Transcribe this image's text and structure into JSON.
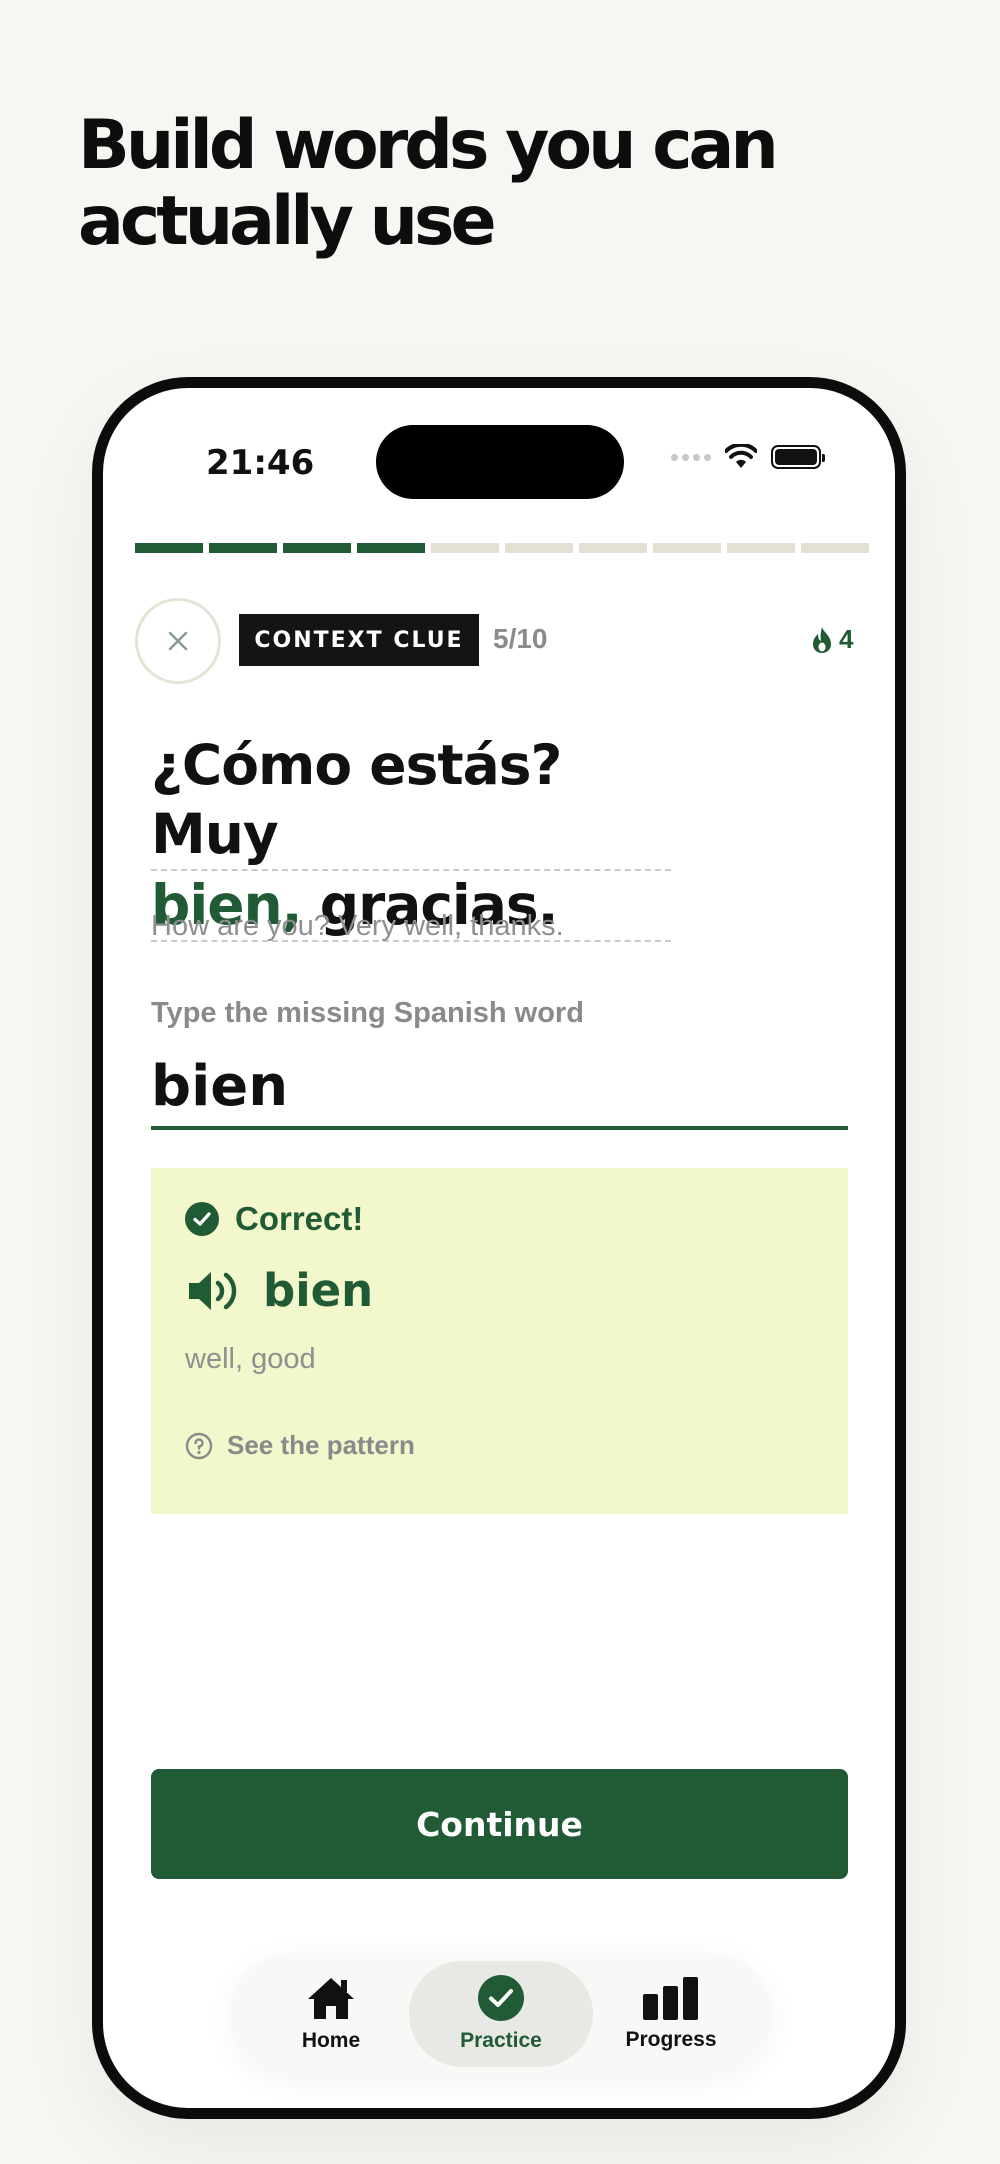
{
  "headline": {
    "line1": "Build words you can",
    "line2": "actually use"
  },
  "status_bar": {
    "time": "21:46"
  },
  "lesson": {
    "progress": {
      "total": 10,
      "completed": 4
    },
    "badge": "CONTEXT CLUE",
    "counter": "5/10",
    "streak": "4"
  },
  "question": {
    "sentence_line1": "¿Cómo estás? Muy",
    "answer_word": "bien,",
    "sentence_rest": " gracias.",
    "translation": "How are you? Very well, thanks.",
    "prompt": "Type the missing Spanish word",
    "input_value": "bien"
  },
  "feedback": {
    "title": "Correct!",
    "word": "bien",
    "meaning": "well, good",
    "link": "See the pattern"
  },
  "continue_label": "Continue",
  "tabs": [
    {
      "label": "Home",
      "icon": "home-icon"
    },
    {
      "label": "Practice",
      "icon": "check-circle-icon",
      "active": true
    },
    {
      "label": "Progress",
      "icon": "bar-chart-icon"
    }
  ],
  "colors": {
    "brand_green": "#215b36",
    "feedback_bg": "#f2f7cc",
    "page_bg": "#f6f6f2"
  }
}
